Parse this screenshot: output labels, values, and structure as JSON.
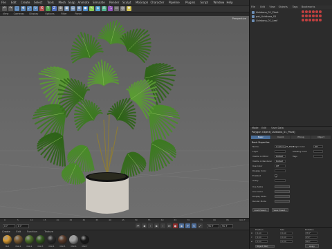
{
  "menubar": {
    "items": [
      "File",
      "Edit",
      "Create",
      "Select",
      "Tools",
      "Mesh",
      "Snap",
      "Animate",
      "Simulate",
      "Render",
      "Sculpt",
      "MoGraph",
      "Character",
      "Pipeline",
      "Plugins",
      "Script",
      "Window",
      "Help"
    ]
  },
  "toolbar": {
    "icons": [
      "undo-icon",
      "redo-icon",
      "live-selection-icon",
      "move-icon",
      "scale-icon",
      "rotate-icon",
      "x-axis-icon",
      "y-axis-icon",
      "z-axis-icon",
      "world-coord-icon",
      "render-view-icon",
      "render-picture-viewer-icon",
      "render-settings-icon",
      "cube-icon",
      "pen-icon",
      "subdivide-icon",
      "array-icon",
      "deformer-icon",
      "floor-icon",
      "camera-icon",
      "light-icon"
    ]
  },
  "viewport": {
    "menu": [
      "View",
      "Cameras",
      "Display",
      "Options",
      "Filter",
      "Panel"
    ],
    "label": "Perspective",
    "colors": {
      "background": "#666666",
      "pot": "#cfcac2",
      "pot_rim": "#111111",
      "leaf": "#3f7a22"
    }
  },
  "timeline": {
    "ticks": [
      "0",
      "5",
      "10",
      "15",
      "20",
      "25",
      "30",
      "35",
      "40",
      "45",
      "50",
      "55",
      "60",
      "65",
      "70",
      "75",
      "80",
      "85",
      "90"
    ],
    "end_label": "0 F"
  },
  "transport": {
    "start_frame": "0 F",
    "current_frame": "0 F",
    "end_frame": "90 F",
    "max_frame": "90 F"
  },
  "materials": {
    "menu": [
      "Create",
      "Edit",
      "Function",
      "Texture"
    ],
    "swatches": [
      {
        "name": "Mat",
        "color": "#d89a30"
      },
      {
        "name": "Mat.1",
        "color": "#7a5a30"
      },
      {
        "name": "Mat.2",
        "color": "#4c6e28"
      },
      {
        "name": "Mat.3",
        "color": "#345a1e"
      },
      {
        "name": "Mat.4",
        "color": "#2b2b2b"
      },
      {
        "name": "Mat.5",
        "color": "#5a3b2a"
      },
      {
        "name": "Mat.6",
        "color": "#a0a0a0"
      },
      {
        "name": "Mat.7",
        "color": "#1a1a1a"
      }
    ]
  },
  "object_manager": {
    "tabs": [
      "File",
      "Edit",
      "View",
      "Objects",
      "Tags",
      "Bookmarks"
    ],
    "objects": [
      "Livistona_01_Plant",
      "pot_Livistona_01",
      "Livistona_01_Leaf"
    ]
  },
  "attribute_manager": {
    "menu": [
      "Mode",
      "Edit",
      "User Data"
    ],
    "title": "Polygon Object [Livistona_01_Plant]",
    "tabs": [
      "Basic",
      "Coord.",
      "Phong",
      "Object"
    ],
    "active_tab": "Basic",
    "section": "Basic Properties",
    "fields": [
      {
        "label": "Name",
        "value": "Livistona_01_Plant"
      },
      {
        "label": "Layer",
        "value": ""
      },
      {
        "label": "Visible in Editor",
        "value": "Default"
      },
      {
        "label": "Visible in Renderer",
        "value": "Default"
      },
      {
        "label": "Use Color",
        "value": "Off"
      },
      {
        "label": "Display Color",
        "value": ""
      },
      {
        "label": "Enabled",
        "value": "✓"
      },
      {
        "label": "X-Ray",
        "value": ""
      }
    ],
    "right_fields": [
      {
        "label": "Origin Color",
        "value": "Off"
      },
      {
        "label": "Shading Color",
        "value": ""
      },
      {
        "label": "Tags",
        "value": ""
      }
    ],
    "extra_labels": [
      "Use Alpha",
      "Icon Color",
      "Display Mode",
      "Render Mode"
    ],
    "buttons": [
      "Load Preset...",
      "Save Preset..."
    ]
  },
  "coordinates": {
    "headers": [
      "Position",
      "Size",
      "Rotation"
    ],
    "rows": [
      {
        "axis": "X",
        "pos": "0 cm",
        "size": "0 cm",
        "rot": "H 0°"
      },
      {
        "axis": "Y",
        "pos": "0 cm",
        "size": "0 cm",
        "rot": "P 0°"
      },
      {
        "axis": "Z",
        "pos": "0 cm",
        "size": "0 cm",
        "rot": "B 0°"
      }
    ],
    "mode": "Object (Rel)",
    "apply_label": "Apply"
  }
}
